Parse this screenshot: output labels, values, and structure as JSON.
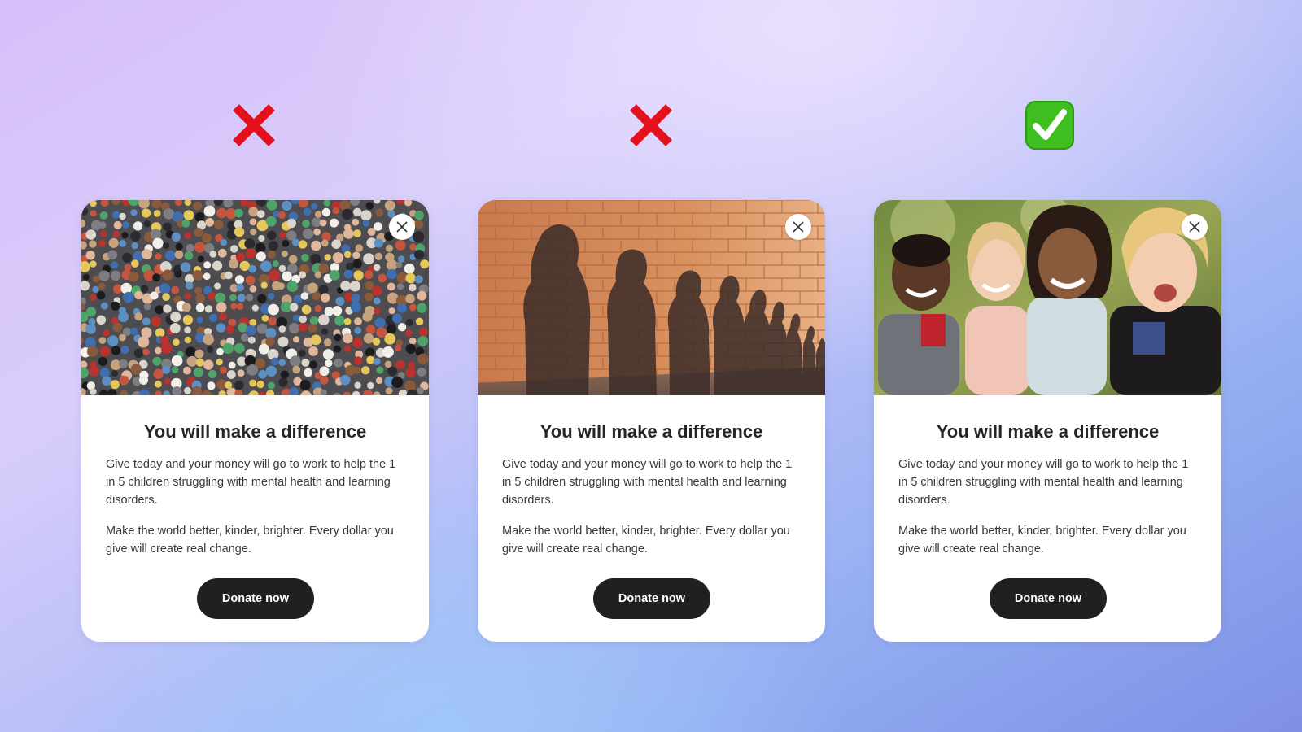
{
  "verdicts": [
    {
      "icon": "red-cross-icon",
      "meaning": "bad example",
      "color": "#e4111c"
    },
    {
      "icon": "red-cross-icon",
      "meaning": "bad example",
      "color": "#e4111c"
    },
    {
      "icon": "green-check-icon",
      "meaning": "good example",
      "color": "#3fbf1f"
    }
  ],
  "cards": [
    {
      "image": "crowd-photo",
      "title": "You will make a difference",
      "paragraph1": "Give today and your money will go to work to help the 1 in 5 children struggling with mental health and learning disorders.",
      "paragraph2": "Make the world better, kinder, brighter. Every dollar you give will create real change.",
      "button_label": "Donate now",
      "close_icon": "close-icon"
    },
    {
      "image": "shadows-on-brick-wall-photo",
      "title": "You will make a difference",
      "paragraph1": "Give today and your money will go to work to help the 1 in 5 children struggling with mental health and learning disorders.",
      "paragraph2": "Make the world better, kinder, brighter. Every dollar you give will create real change.",
      "button_label": "Donate now",
      "close_icon": "close-icon"
    },
    {
      "image": "smiling-children-photo",
      "title": "You will make a difference",
      "paragraph1": "Give today and your money will go to work to help the 1 in 5 children struggling with mental health and learning disorders.",
      "paragraph2": "Make the world better, kinder, brighter. Every dollar you give will create real change.",
      "button_label": "Donate now",
      "close_icon": "close-icon"
    }
  ],
  "colors": {
    "card_bg": "#ffffff",
    "button_bg": "#221f22",
    "button_text": "#ffffff",
    "title_text": "#26242a"
  }
}
